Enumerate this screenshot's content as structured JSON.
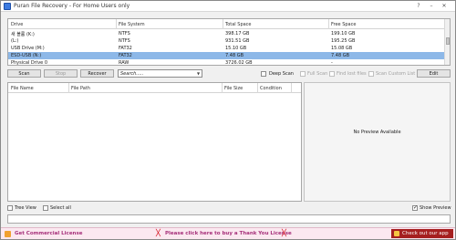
{
  "window": {
    "title": "Puran File Recovery - For Home Users only",
    "help_label": "?",
    "minimize_label": "–",
    "close_label": "✕"
  },
  "drives": {
    "columns": [
      "Drive",
      "File System",
      "Total Space",
      "Free Space"
    ],
    "rows": [
      {
        "drive": "새 볼륨 (K:)",
        "fs": "NTFS",
        "total": "398.17 GB",
        "free": "199.10 GB",
        "selected": false
      },
      {
        "drive": "(L:)",
        "fs": "NTFS",
        "total": "931.51 GB",
        "free": "195.25 GB",
        "selected": false
      },
      {
        "drive": "USB Drive (M:)",
        "fs": "FAT32",
        "total": "15.10 GB",
        "free": "15.08 GB",
        "selected": false
      },
      {
        "drive": "ESD-USB (N:)",
        "fs": "FAT32",
        "total": "7.48 GB",
        "free": "7.48 GB",
        "selected": true
      },
      {
        "drive": "Physical Drive 0",
        "fs": "RAW",
        "total": "3726.02 GB",
        "free": "-",
        "selected": false
      }
    ]
  },
  "toolbar": {
    "scan": "Scan",
    "stop": "Stop",
    "recover": "Recover",
    "search_value": "Search.....",
    "deep_scan": "Deep Scan",
    "full_scan": "Full Scan",
    "find_lost_files": "Find lost files",
    "scan_custom_list": "Scan Custom List",
    "edit": "Edit"
  },
  "results": {
    "columns": [
      "File Name",
      "File Path",
      "File Size",
      "Condition"
    ]
  },
  "preview": {
    "text": "No Preview Available"
  },
  "options": {
    "tree_view": "Tree View",
    "select_all": "Select all",
    "show_preview": "Show Preview"
  },
  "footer": {
    "commercial": "Get Commercial License",
    "thank_you": "Please click here to buy a Thank You License",
    "apps": "Check out our app"
  },
  "colors": {
    "selected_row": "#8db8e8",
    "footer_bg": "#fbe8f0",
    "footer_text": "#a6307a",
    "apps_button": "#a51f1f"
  }
}
